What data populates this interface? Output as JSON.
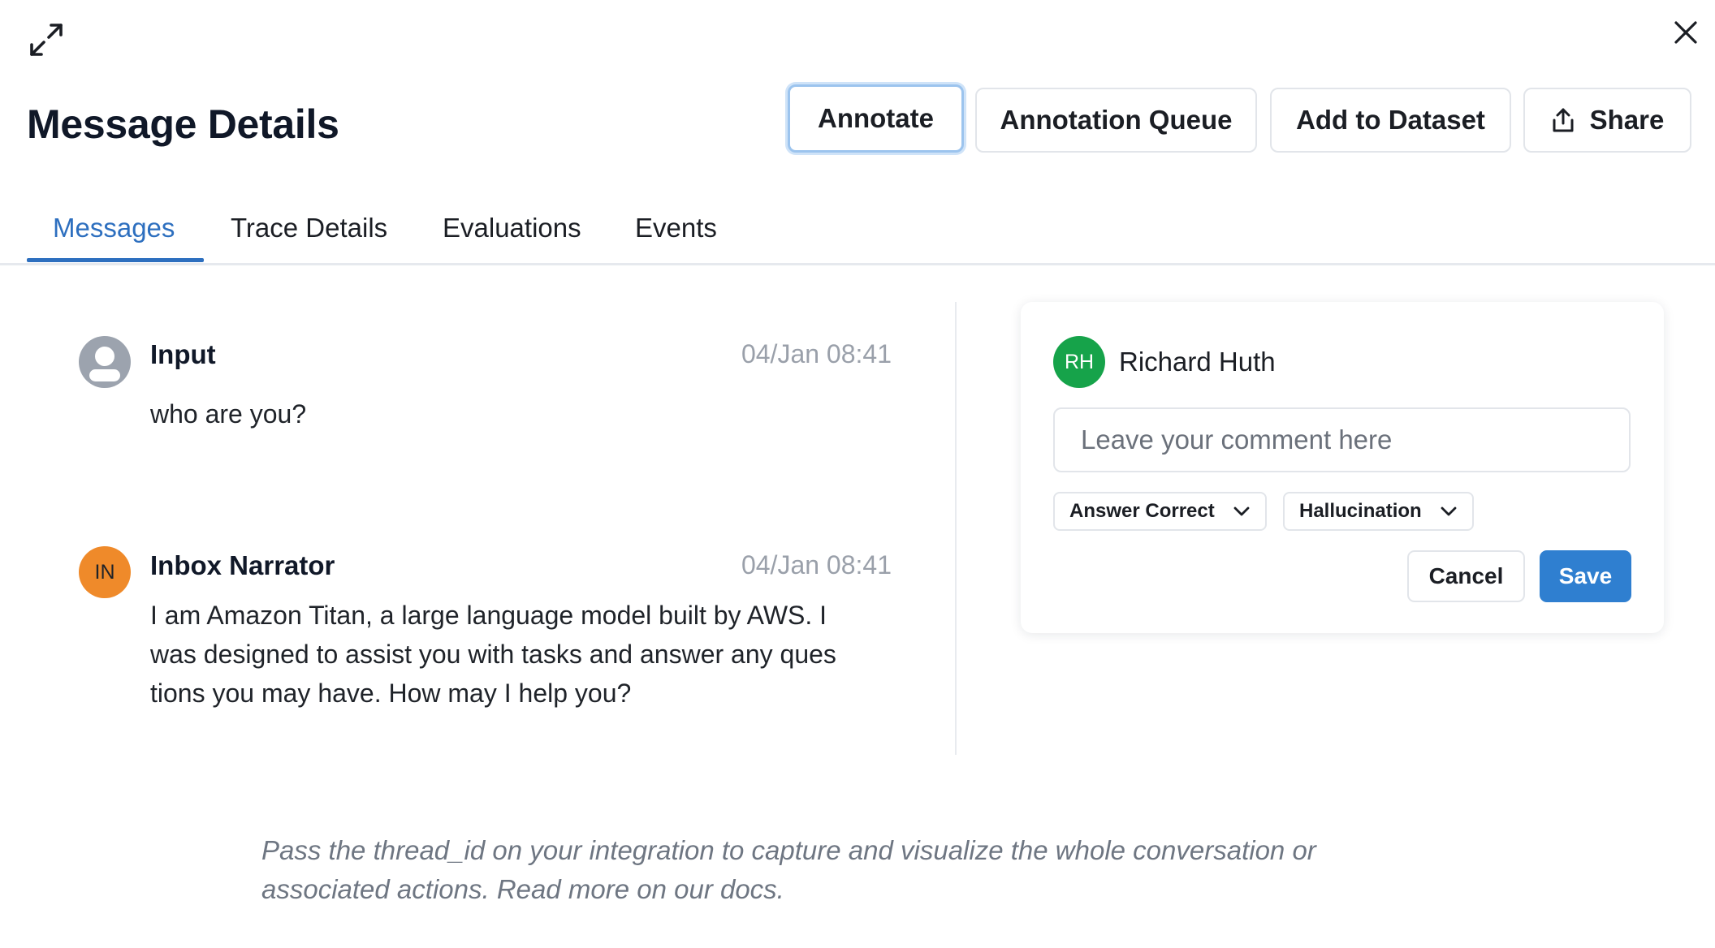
{
  "header": {
    "title": "Message Details",
    "expand_icon": "expand-arrows-icon",
    "close_icon": "close-icon"
  },
  "toolbar": {
    "annotate_label": "Annotate",
    "annotation_queue_label": "Annotation Queue",
    "add_to_dataset_label": "Add to Dataset",
    "share_label": "Share",
    "share_icon": "share-upload-icon"
  },
  "tabs": [
    {
      "label": "Messages",
      "active": true
    },
    {
      "label": "Trace Details",
      "active": false
    },
    {
      "label": "Evaluations",
      "active": false
    },
    {
      "label": "Events",
      "active": false
    }
  ],
  "messages": [
    {
      "author": "Input",
      "timestamp": "04/Jan 08:41",
      "avatar_icon": "user-avatar-icon",
      "text": "who are you?"
    },
    {
      "author": "Inbox Narrator",
      "timestamp": "04/Jan 08:41",
      "avatar_initials": "IN",
      "avatar_color": "#ef8a2a",
      "text_lines": [
        "I am Amazon Titan, a large language model built by AWS. I",
        "was designed to assist you with tasks and answer any ques",
        "tions you may have. How may I help you?"
      ]
    }
  ],
  "annotation": {
    "user_initials": "RH",
    "user_name": "Richard Huth",
    "user_color": "#16a34a",
    "comment_placeholder": "Leave your comment here",
    "comment_value": "",
    "chips": [
      {
        "label": "Answer Correct"
      },
      {
        "label": "Hallucination"
      }
    ],
    "cancel_label": "Cancel",
    "save_label": "Save",
    "save_color": "#2f7fd0"
  },
  "footer": {
    "line1": "Pass the thread_id on your integration to capture and visualize the whole conversation or",
    "line2": "associated actions. Read more on our docs."
  }
}
